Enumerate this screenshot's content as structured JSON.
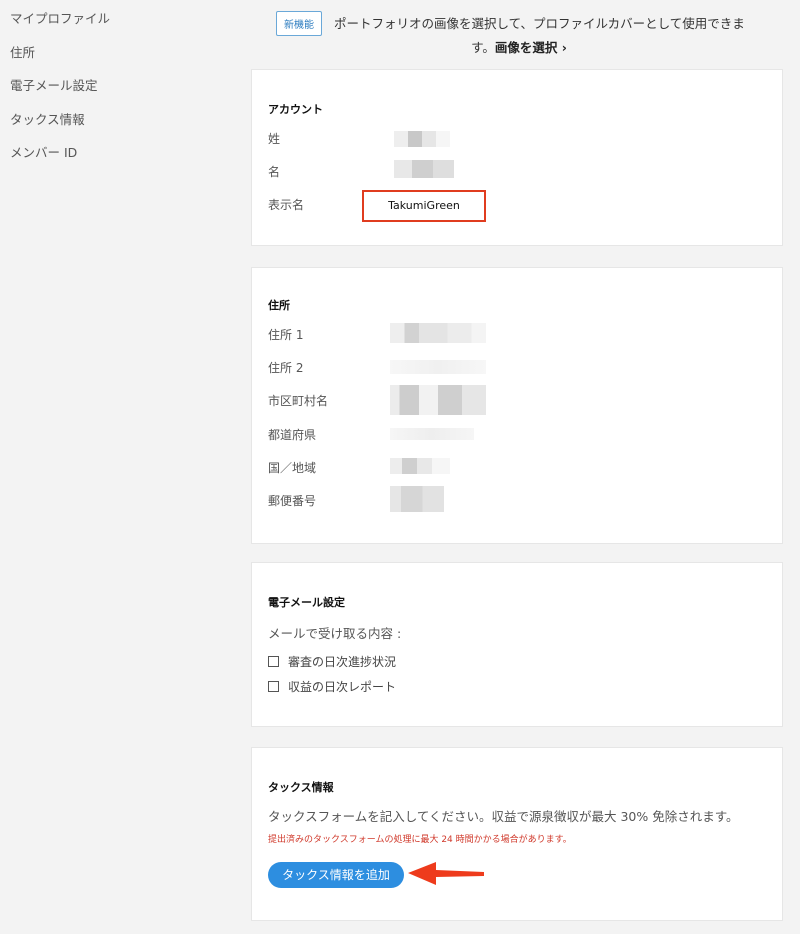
{
  "sidebar": {
    "items": [
      {
        "label": "マイプロファイル"
      },
      {
        "label": "住所"
      },
      {
        "label": "電子メール設定"
      },
      {
        "label": "タックス情報"
      },
      {
        "label": "メンバー ID"
      }
    ]
  },
  "banner": {
    "badge": "新機能",
    "text_line1": "ポートフォリオの画像を選択して、プロファイルカバーとして使用できま",
    "text_line2": "す。",
    "link": "画像を選択 ›"
  },
  "account": {
    "title": "アカウント",
    "fields": [
      {
        "label": "姓"
      },
      {
        "label": "名"
      },
      {
        "label": "表示名",
        "value": "TakumiGreen"
      }
    ]
  },
  "address": {
    "title": "住所",
    "fields": [
      {
        "label": "住所 1"
      },
      {
        "label": "住所 2"
      },
      {
        "label": "市区町村名"
      },
      {
        "label": "都道府県"
      },
      {
        "label": "国／地域"
      },
      {
        "label": "郵便番号"
      }
    ]
  },
  "email": {
    "title": "電子メール設定",
    "subtitle": "メールで受け取る内容 :",
    "options": [
      {
        "label": "審査の日次進捗状況",
        "checked": false
      },
      {
        "label": "収益の日次レポート",
        "checked": false
      }
    ]
  },
  "tax": {
    "title": "タックス情報",
    "description": "タックスフォームを記入してください。収益で源泉徴収が最大 30% 免除されます。",
    "note": "提出済みのタックスフォームの処理に最大 24 時間かかる場合があります。",
    "button": "タックス情報を追加"
  },
  "colors": {
    "highlight_box": "#e03c1f",
    "button": "#2d8ee0",
    "note": "#d0392b",
    "arrow": "#ee3b1c"
  }
}
